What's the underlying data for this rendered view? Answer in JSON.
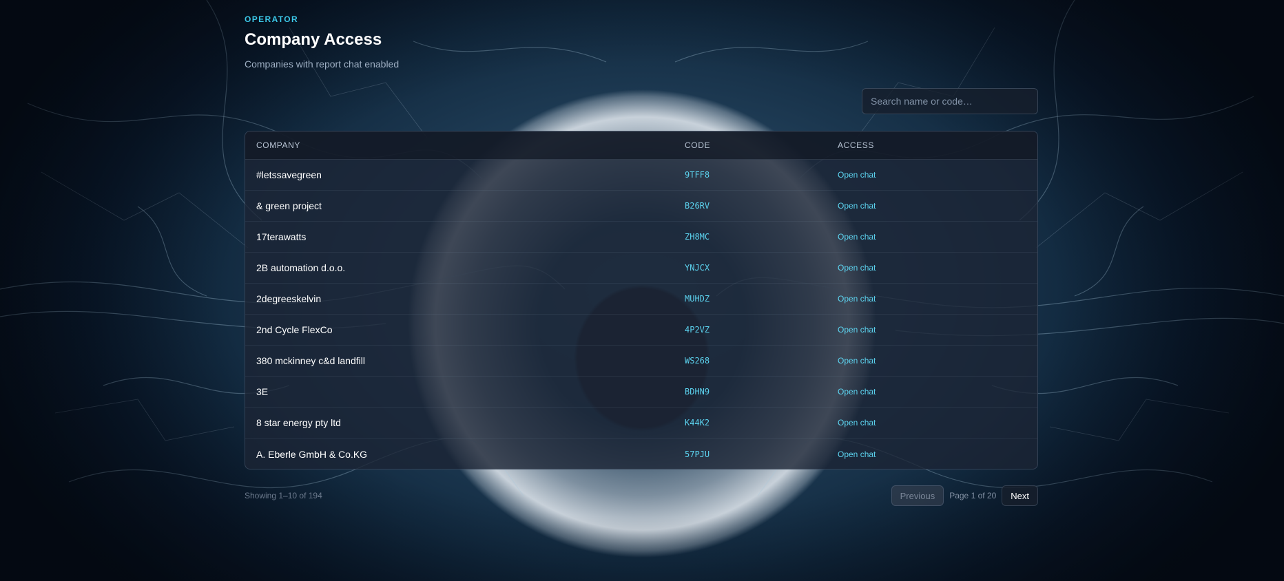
{
  "header": {
    "eyebrow": "OPERATOR",
    "title": "Company Access",
    "subtitle": "Companies with report chat enabled"
  },
  "search": {
    "placeholder": "Search name or code…",
    "value": ""
  },
  "table": {
    "columns": [
      "COMPANY",
      "CODE",
      "ACCESS"
    ],
    "rows": [
      {
        "company": "#letssavegreen",
        "code": "9TFF8",
        "access": "Open chat"
      },
      {
        "company": "& green project",
        "code": "B26RV",
        "access": "Open chat"
      },
      {
        "company": "17terawatts",
        "code": "ZH8MC",
        "access": "Open chat"
      },
      {
        "company": "2B automation d.o.o.",
        "code": "YNJCX",
        "access": "Open chat"
      },
      {
        "company": "2degreeskelvin",
        "code": "MUHDZ",
        "access": "Open chat"
      },
      {
        "company": "2nd Cycle FlexCo",
        "code": "4P2VZ",
        "access": "Open chat"
      },
      {
        "company": "380 mckinney c&d landfill",
        "code": "WS268",
        "access": "Open chat"
      },
      {
        "company": "3E",
        "code": "BDHN9",
        "access": "Open chat"
      },
      {
        "company": "8 star energy pty ltd",
        "code": "K44K2",
        "access": "Open chat"
      },
      {
        "company": "A. Eberle GmbH & Co.KG",
        "code": "57PJU",
        "access": "Open chat"
      }
    ]
  },
  "pagination": {
    "showing": "Showing 1–10 of 194",
    "previous_label": "Previous",
    "page_info": "Page 1 of 20",
    "next_label": "Next"
  },
  "colors": {
    "accent": "#3cc8e8",
    "link": "#5cd3ef",
    "background": "#0b1a2a"
  }
}
